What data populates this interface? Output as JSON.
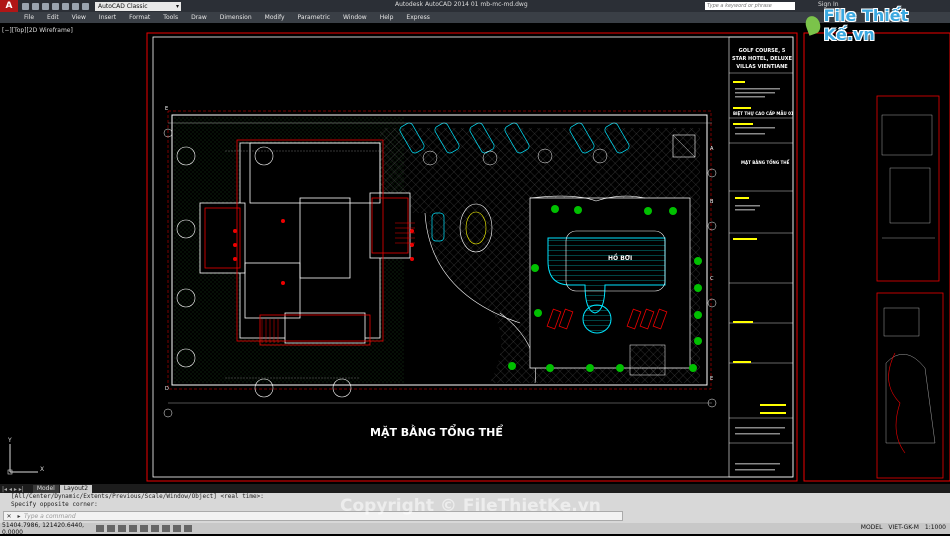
{
  "app": {
    "logo_letter": "A",
    "workspace": "AutoCAD Classic",
    "title": "Autodesk AutoCAD 2014    01 mb-mc-md.dwg",
    "search_placeholder": "Type a keyword or phrase",
    "signin": "Sign In"
  },
  "menu": [
    "File",
    "Edit",
    "View",
    "Insert",
    "Format",
    "Tools",
    "Draw",
    "Dimension",
    "Modify",
    "Parametric",
    "Window",
    "Help",
    "Express"
  ],
  "brand_logo": "File Thiết Kế.vn",
  "viewport_label": "[−][Top][2D Wireframe]",
  "drawing": {
    "plan_title": "MẶT BẰNG TỔNG THỂ",
    "pool_label": "HỒ BƠI",
    "grid_letters_left": [
      "E",
      "D"
    ],
    "grid_letters_right": [
      "A",
      "B",
      "C",
      "E"
    ],
    "title_block": {
      "project": "GOLF COURSE, 5 STAR HOTEL, DELUXE VILLAS VIENTIANE",
      "subtitle": "BIỆT THỰ CAO CẤP MẪU 01",
      "sheet": "MẶT BẰNG TỔNG THỂ"
    }
  },
  "ucs": {
    "y": "Y",
    "x": "X"
  },
  "tabs": {
    "nav": "|◂ ◂ ▸ ▸|",
    "model": "Model",
    "layout": "Layout2"
  },
  "command": {
    "history": [
      "[All/Center/Dynamic/Extents/Previous/Scale/Window/Object] <real time>:",
      "Specify opposite corner:"
    ],
    "placeholder": "Type a command"
  },
  "status": {
    "coords": "51404.7986, 121420.6440, 0.0000",
    "model": "MODEL",
    "annotation": "VIET-GK-M",
    "scale": "1:1000"
  },
  "watermark": "Copyright © FileThietKe.vn",
  "colors": {
    "accent": "#b01616",
    "cad_red": "#ff2020",
    "cad_green": "#00c000",
    "cad_cyan": "#00e5ff",
    "cad_yellow": "#ffff00"
  }
}
